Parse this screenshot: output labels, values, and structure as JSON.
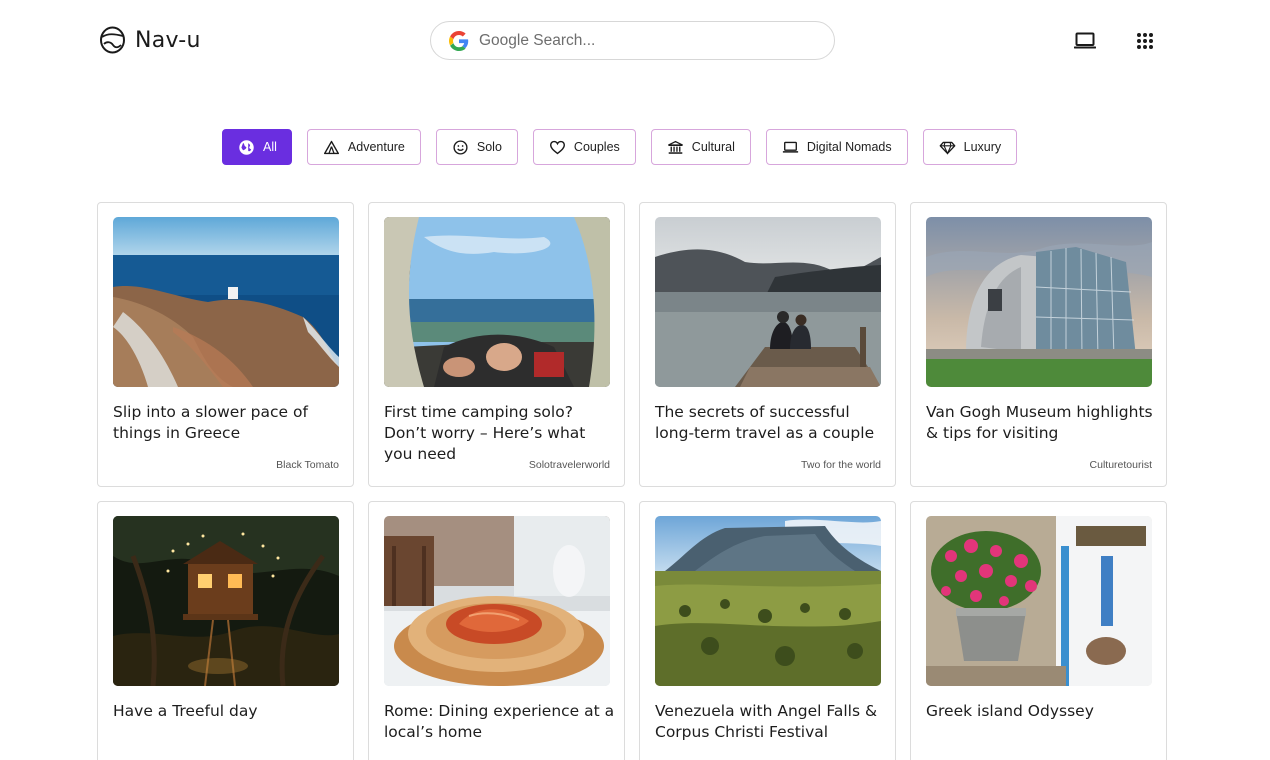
{
  "header": {
    "logo_text": "Nav-u",
    "search_placeholder": "Google Search..."
  },
  "filters": [
    {
      "label": "All",
      "icon": "globe-icon",
      "active": true
    },
    {
      "label": "Adventure",
      "icon": "tent-icon",
      "active": false
    },
    {
      "label": "Solo",
      "icon": "smiley-icon",
      "active": false
    },
    {
      "label": "Couples",
      "icon": "heart-icon",
      "active": false
    },
    {
      "label": "Cultural",
      "icon": "museum-icon",
      "active": false
    },
    {
      "label": "Digital Nomads",
      "icon": "laptop-icon",
      "active": false
    },
    {
      "label": "Luxury",
      "icon": "diamond-icon",
      "active": false
    }
  ],
  "cards": [
    {
      "title": "Slip into a slower pace of things in Greece",
      "source": "Black Tomato",
      "image": "greek-coastline-photo"
    },
    {
      "title": "First time camping solo? Don’t worry – Here’s what you need",
      "source": "Solotravelerworld",
      "image": "tent-sea-view-photo"
    },
    {
      "title": "The secrets of successful long-term travel as a couple",
      "source": "Two for the world",
      "image": "couple-on-pier-photo"
    },
    {
      "title": "Van Gogh Museum highlights & tips for visiting",
      "source": "Culturetourist",
      "image": "museum-building-photo"
    },
    {
      "title": "Have a Treeful day",
      "source": "",
      "image": "treehouse-night-photo"
    },
    {
      "title": "Rome: Dining experience at a local’s home",
      "source": "",
      "image": "pasta-plate-photo"
    },
    {
      "title": "Venezuela with Angel Falls & Corpus Christi Festival",
      "source": "",
      "image": "tepui-landscape-photo"
    },
    {
      "title": "Greek island Odyssey",
      "source": "",
      "image": "flower-street-photo"
    }
  ],
  "colors": {
    "accent": "#6a2ee0",
    "chip_border": "#d7a6dc",
    "card_border": "#dcdcdc"
  }
}
